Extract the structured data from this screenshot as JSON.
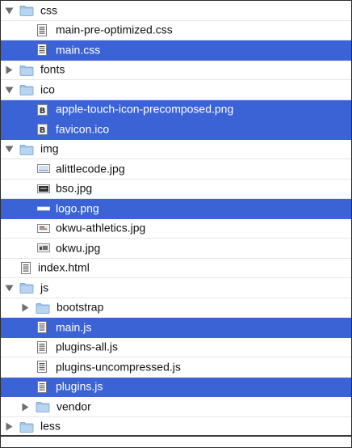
{
  "tree": {
    "rows": [
      {
        "label": "css",
        "kind": "folder",
        "expanded": true,
        "selected": false,
        "icon": "folder-icon",
        "level": 0
      },
      {
        "label": "main-pre-optimized.css",
        "kind": "file",
        "selected": false,
        "icon": "css-file-icon",
        "level": 1
      },
      {
        "label": "main.css",
        "kind": "file",
        "selected": true,
        "icon": "css-file-icon",
        "level": 1
      },
      {
        "label": "fonts",
        "kind": "folder",
        "expanded": false,
        "selected": false,
        "icon": "folder-icon",
        "level": 0
      },
      {
        "label": "ico",
        "kind": "folder",
        "expanded": true,
        "selected": false,
        "icon": "folder-icon",
        "level": 0
      },
      {
        "label": "apple-touch-icon-precomposed.png",
        "kind": "file",
        "selected": true,
        "icon": "image-b-icon",
        "level": 1
      },
      {
        "label": "favicon.ico",
        "kind": "file",
        "selected": true,
        "icon": "image-b-icon",
        "level": 1
      },
      {
        "label": "img",
        "kind": "folder",
        "expanded": true,
        "selected": false,
        "icon": "folder-icon",
        "level": 0
      },
      {
        "label": "alittlecode.jpg",
        "kind": "file",
        "selected": false,
        "icon": "image-thumb-icon",
        "level": 1
      },
      {
        "label": "bso.jpg",
        "kind": "file",
        "selected": false,
        "icon": "image-thumb-icon",
        "level": 1
      },
      {
        "label": "logo.png",
        "kind": "file",
        "selected": true,
        "icon": "image-line-icon",
        "level": 1
      },
      {
        "label": "okwu-athletics.jpg",
        "kind": "file",
        "selected": false,
        "icon": "image-thumb-icon",
        "level": 1
      },
      {
        "label": "okwu.jpg",
        "kind": "file",
        "selected": false,
        "icon": "image-thumb-icon",
        "level": 1
      },
      {
        "label": "index.html",
        "kind": "file",
        "selected": false,
        "icon": "html-file-icon",
        "level": 0
      },
      {
        "label": "js",
        "kind": "folder",
        "expanded": true,
        "selected": false,
        "icon": "folder-icon",
        "level": 0
      },
      {
        "label": "bootstrap",
        "kind": "folder",
        "expanded": false,
        "selected": false,
        "icon": "folder-icon",
        "level": 1
      },
      {
        "label": "main.js",
        "kind": "file",
        "selected": true,
        "icon": "js-file-icon",
        "level": 1
      },
      {
        "label": "plugins-all.js",
        "kind": "file",
        "selected": false,
        "icon": "js-file-icon",
        "level": 1
      },
      {
        "label": "plugins-uncompressed.js",
        "kind": "file",
        "selected": false,
        "icon": "js-file-icon",
        "level": 1
      },
      {
        "label": "plugins.js",
        "kind": "file",
        "selected": true,
        "icon": "js-file-icon",
        "level": 1
      },
      {
        "label": "vendor",
        "kind": "folder",
        "expanded": false,
        "selected": false,
        "icon": "folder-icon",
        "level": 1
      },
      {
        "label": "less",
        "kind": "folder",
        "expanded": false,
        "selected": false,
        "icon": "folder-icon",
        "level": 0
      }
    ]
  },
  "colors": {
    "selection": "#3b63d6",
    "folder": "#9dc3e8",
    "text": "#111111"
  }
}
